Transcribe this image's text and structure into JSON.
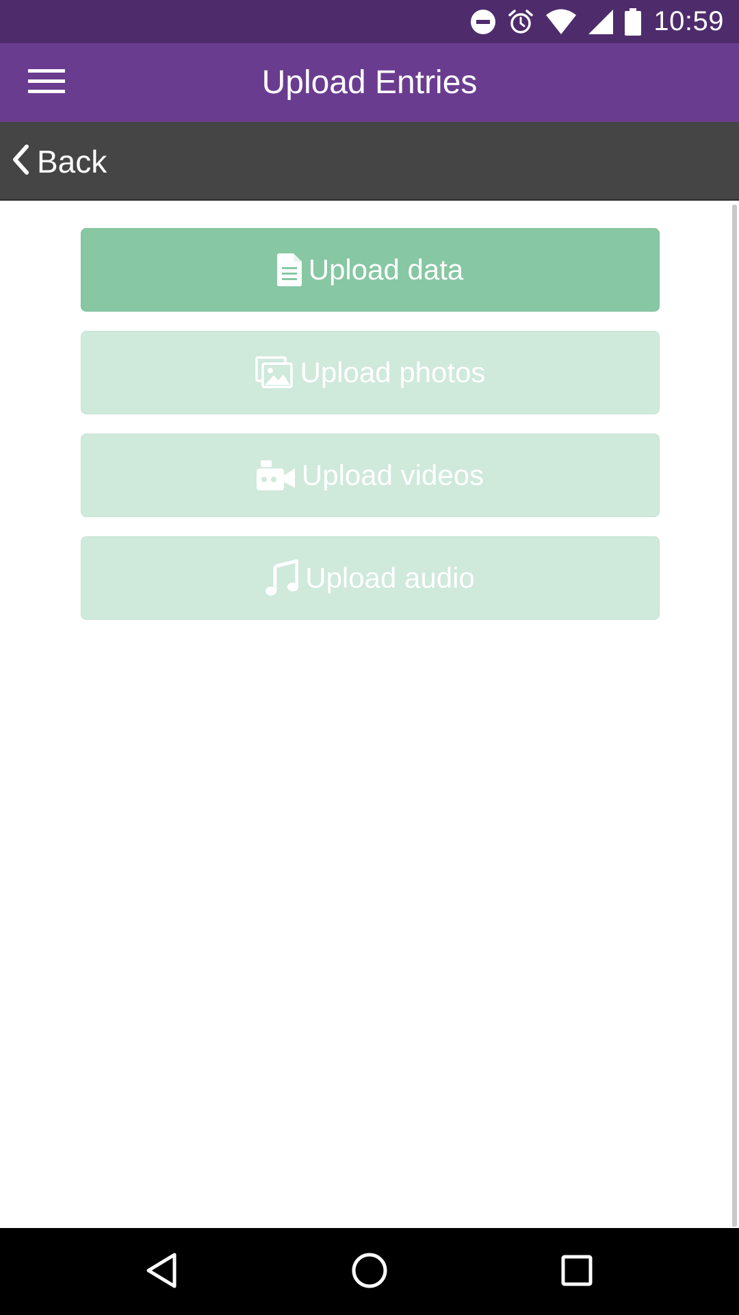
{
  "status_bar": {
    "time": "10:59",
    "icons": [
      "do-not-disturb-icon",
      "alarm-icon",
      "wifi-icon",
      "cell-signal-icon",
      "battery-icon"
    ]
  },
  "app_bar": {
    "title": "Upload Entries",
    "menu_icon": "hamburger-menu-icon"
  },
  "nav_bar": {
    "back_label": "Back",
    "back_icon": "chevron-left-icon"
  },
  "upload_buttons": [
    {
      "label": "Upload data",
      "icon": "document-icon",
      "state": "enabled"
    },
    {
      "label": "Upload photos",
      "icon": "photos-icon",
      "state": "disabled"
    },
    {
      "label": "Upload videos",
      "icon": "video-camera-icon",
      "state": "disabled"
    },
    {
      "label": "Upload audio",
      "icon": "music-note-icon",
      "state": "disabled"
    }
  ],
  "system_nav": {
    "icons": [
      "back-triangle-icon",
      "home-circle-icon",
      "recents-square-icon"
    ]
  },
  "colors": {
    "status_bar": "#4e2c6c",
    "app_bar": "#6a3c8f",
    "nav_bar": "#454545",
    "button_enabled": "#87c7a3",
    "button_disabled": "#cfe9db"
  }
}
